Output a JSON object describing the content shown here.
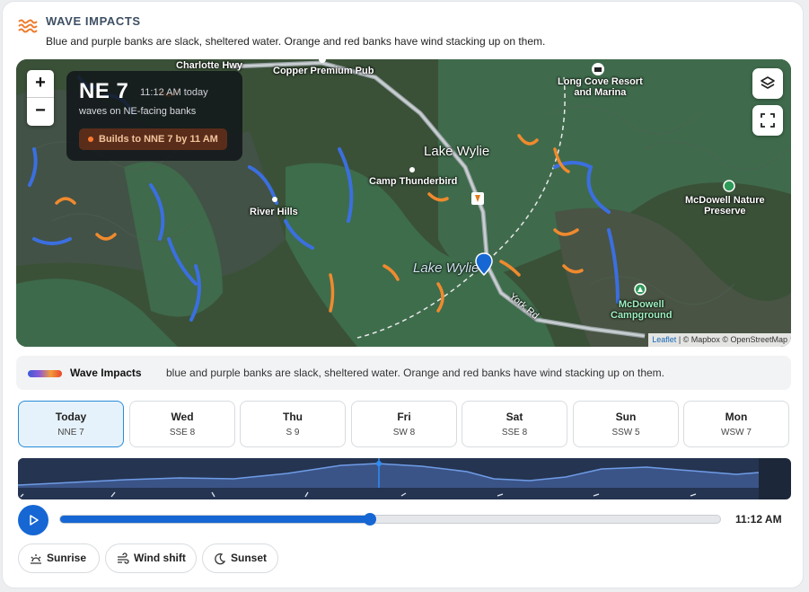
{
  "header": {
    "title": "WAVE IMPACTS",
    "subtitle": "Blue and purple banks are slack, sheltered water. Orange and red banks have wind stacking up on them."
  },
  "map": {
    "zoom_in": "+",
    "zoom_out": "−",
    "info": {
      "wind": "NE 7",
      "time": "11:12 AM today",
      "sub": "waves on NE-facing banks",
      "badge": "Builds to NNE 7 by 11 AM"
    },
    "labels": {
      "charlotte": "Charlotte Hwy",
      "copper": "Copper Premium Pub",
      "longcove": "Long Cove Resort\nand Marina",
      "lakewylie_town": "Lake Wylie",
      "camp": "Camp Thunderbird",
      "riverhills": "River Hills",
      "lakewylie_water": "Lake Wylie",
      "mcdowell_nature": "McDowell Nature\nPreserve",
      "mcdowell_camp": "McDowell\nCampground",
      "yorkrd": "York Rd"
    },
    "attribution": {
      "leaflet": "Leaflet",
      "rest": "| © Mapbox © OpenStreetMap"
    }
  },
  "legend": {
    "title": "Wave Impacts",
    "text": "blue and purple banks are slack, sheltered water. Orange and red banks have wind stacking up on them."
  },
  "days": [
    {
      "name": "Today",
      "wind": "NNE 7",
      "active": true
    },
    {
      "name": "Wed",
      "wind": "SSE 8"
    },
    {
      "name": "Thu",
      "wind": "S 9"
    },
    {
      "name": "Fri",
      "wind": "SW 8"
    },
    {
      "name": "Sat",
      "wind": "SSE 8"
    },
    {
      "name": "Sun",
      "wind": "SSW 5"
    },
    {
      "name": "Mon",
      "wind": "WSW 7"
    }
  ],
  "timeline": {
    "current_time": "11:12 AM",
    "progress": 0.47
  },
  "chips": [
    {
      "label": "Sunrise",
      "icon": "sunrise-icon"
    },
    {
      "label": "Wind shift",
      "icon": "wind-icon"
    },
    {
      "label": "Sunset",
      "icon": "moon-icon"
    }
  ],
  "colors": {
    "accent": "#1667d3",
    "sheltered": "#3b6fe0",
    "exposed": "#f08a2e",
    "header_icon": "#f07a2a"
  }
}
